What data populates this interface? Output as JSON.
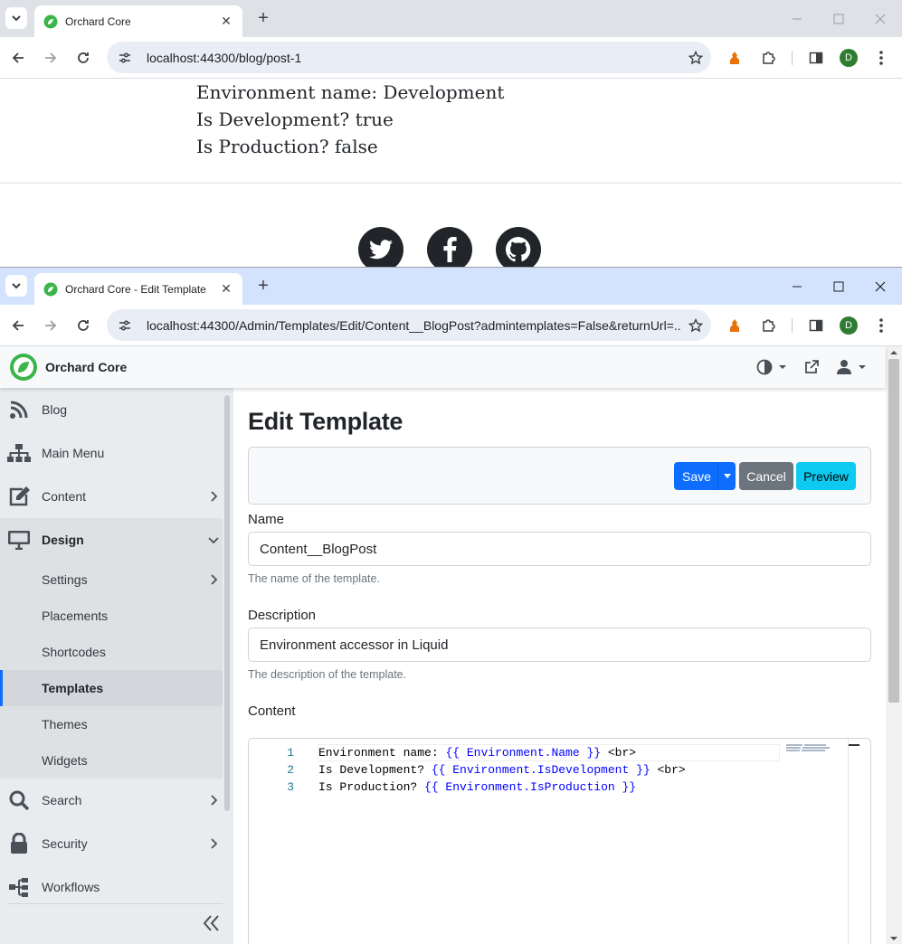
{
  "window1": {
    "tab_title": "Orchard Core",
    "url": "localhost:44300/blog/post-1",
    "profile_initial": "D",
    "page_lines": [
      "Environment name: Development",
      "Is Development? true",
      "Is Production? false"
    ],
    "social": [
      "twitter-icon",
      "facebook-icon",
      "github-icon"
    ]
  },
  "window2": {
    "tab_title": "Orchard Core - Edit Template",
    "url": "localhost:44300/Admin/Templates/Edit/Content__BlogPost?admintemplates=False&returnUrl=...",
    "profile_initial": "D"
  },
  "admin": {
    "brand": "Orchard Core",
    "sidebar": {
      "items": [
        {
          "label": "Blog",
          "icon": "rss-icon"
        },
        {
          "label": "Main Menu",
          "icon": "sitemap-icon"
        },
        {
          "label": "Content",
          "icon": "edit-icon"
        },
        {
          "label": "Design",
          "icon": "desktop-icon"
        },
        {
          "label": "Search",
          "icon": "search-icon"
        },
        {
          "label": "Security",
          "icon": "lock-icon"
        },
        {
          "label": "Workflows",
          "icon": "workflow-icon"
        }
      ],
      "design_sub": [
        "Settings",
        "Placements",
        "Shortcodes",
        "Templates",
        "Themes",
        "Widgets"
      ],
      "active_sub": "Templates"
    },
    "page_title": "Edit Template",
    "buttons": {
      "save": "Save",
      "cancel": "Cancel",
      "preview": "Preview"
    },
    "name": {
      "label": "Name",
      "value": "Content__BlogPost",
      "help": "The name of the template."
    },
    "description": {
      "label": "Description",
      "value": "Environment accessor in Liquid",
      "help": "The description of the template."
    },
    "content": {
      "label": "Content",
      "lines": [
        {
          "num": "1",
          "pre": "Environment name: ",
          "expr": "{{ Environment.Name }}",
          "post": " <br>"
        },
        {
          "num": "2",
          "pre": "Is Development? ",
          "expr": "{{ Environment.IsDevelopment }}",
          "post": " <br>"
        },
        {
          "num": "3",
          "pre": "Is Production? ",
          "expr": "{{ Environment.IsProduction }}",
          "post": ""
        }
      ]
    },
    "colors": {
      "save": "#0d6efd",
      "cancel": "#6c757d",
      "preview": "#0dcaf0",
      "active_bg": "#d3d6da",
      "brand_green": "#3bb54a"
    }
  }
}
